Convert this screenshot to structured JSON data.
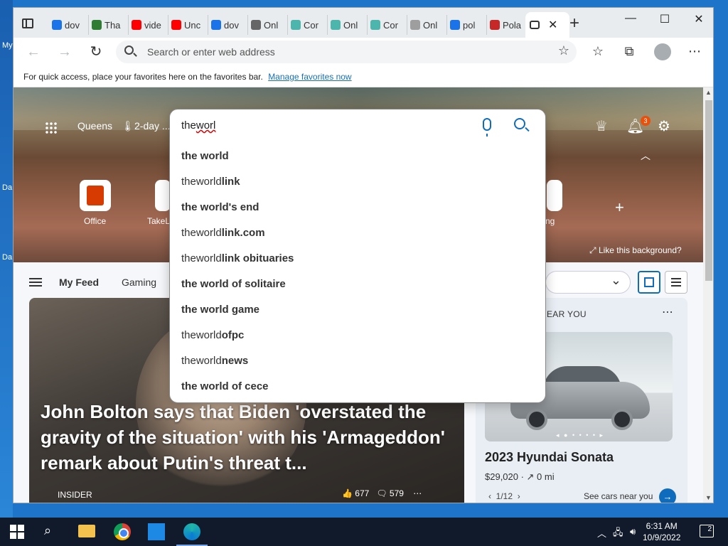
{
  "desktop": {
    "labels": [
      "My",
      "Da",
      "Da"
    ]
  },
  "tabs": [
    {
      "label": "dov",
      "icon": "search-icon",
      "color": "#1a73e8"
    },
    {
      "label": "Tha",
      "icon": "x-app-icon",
      "color": "#2e7d32"
    },
    {
      "label": "vide",
      "icon": "youtube-icon",
      "color": "#ff0000"
    },
    {
      "label": "Unc",
      "icon": "youtube-icon",
      "color": "#ff0000"
    },
    {
      "label": "dov",
      "icon": "search-icon",
      "color": "#1a73e8"
    },
    {
      "label": "Onl",
      "icon": "document-icon",
      "color": "#666666"
    },
    {
      "label": "Cor",
      "icon": "copilot-icon",
      "color": "#4db6ac"
    },
    {
      "label": "Onl",
      "icon": "copilot-icon",
      "color": "#4db6ac"
    },
    {
      "label": "Cor",
      "icon": "copilot-icon",
      "color": "#4db6ac"
    },
    {
      "label": "Onl",
      "icon": "sst-icon",
      "color": "#9e9e9e"
    },
    {
      "label": "pol",
      "icon": "search-icon",
      "color": "#1a73e8"
    },
    {
      "label": "Pola",
      "icon": "game-icon",
      "color": "#c62828"
    }
  ],
  "window_controls": {
    "minimize": "—",
    "maximize": "☐",
    "close": "✕"
  },
  "address_bar": {
    "placeholder": "Search or enter web address"
  },
  "favorites_bar": {
    "text": "For quick access, place your favorites here on the favorites bar.",
    "link": "Manage favorites now"
  },
  "hero": {
    "location": "Queens",
    "weather": "2-day ...",
    "notification_count": "3",
    "like_background": "Like this background?",
    "tiles": [
      {
        "label": "Office"
      },
      {
        "label": "TakeLe"
      },
      {
        "label": "ng"
      }
    ]
  },
  "search": {
    "typed": "the",
    "typed_rest": "worl",
    "suggestions": [
      {
        "typed": "",
        "rest": "the world"
      },
      {
        "typed": "theworld",
        "rest": "link"
      },
      {
        "typed": "",
        "rest": "the world's end"
      },
      {
        "typed": "theworld",
        "rest": "link.com"
      },
      {
        "typed": "theworld",
        "rest": "link obituaries"
      },
      {
        "typed": "",
        "rest": "the world of solitaire"
      },
      {
        "typed": "",
        "rest": "the world game"
      },
      {
        "typed": "theworld",
        "rest": "ofpc"
      },
      {
        "typed": "theworld",
        "rest": "news"
      },
      {
        "typed": "",
        "rest": "the world of cece"
      }
    ]
  },
  "feed": {
    "tabs": [
      "My Feed",
      "Gaming"
    ],
    "headline": "John Bolton says that Biden 'overstated the gravity of the situation' with his 'Armageddon' remark about Putin's threat t...",
    "source": "INSIDER",
    "reactions": "677",
    "comments": "579"
  },
  "side_card": {
    "title": "NDED CARS NEAR YOU",
    "car": "2023 Hyundai Sonata",
    "price": "$29,020 · ↗ 0 mi",
    "pager": "1/12",
    "cta": "See cars near you"
  },
  "taskbar": {
    "time": "6:31 AM",
    "date": "10/9/2022",
    "notifications": "2"
  }
}
